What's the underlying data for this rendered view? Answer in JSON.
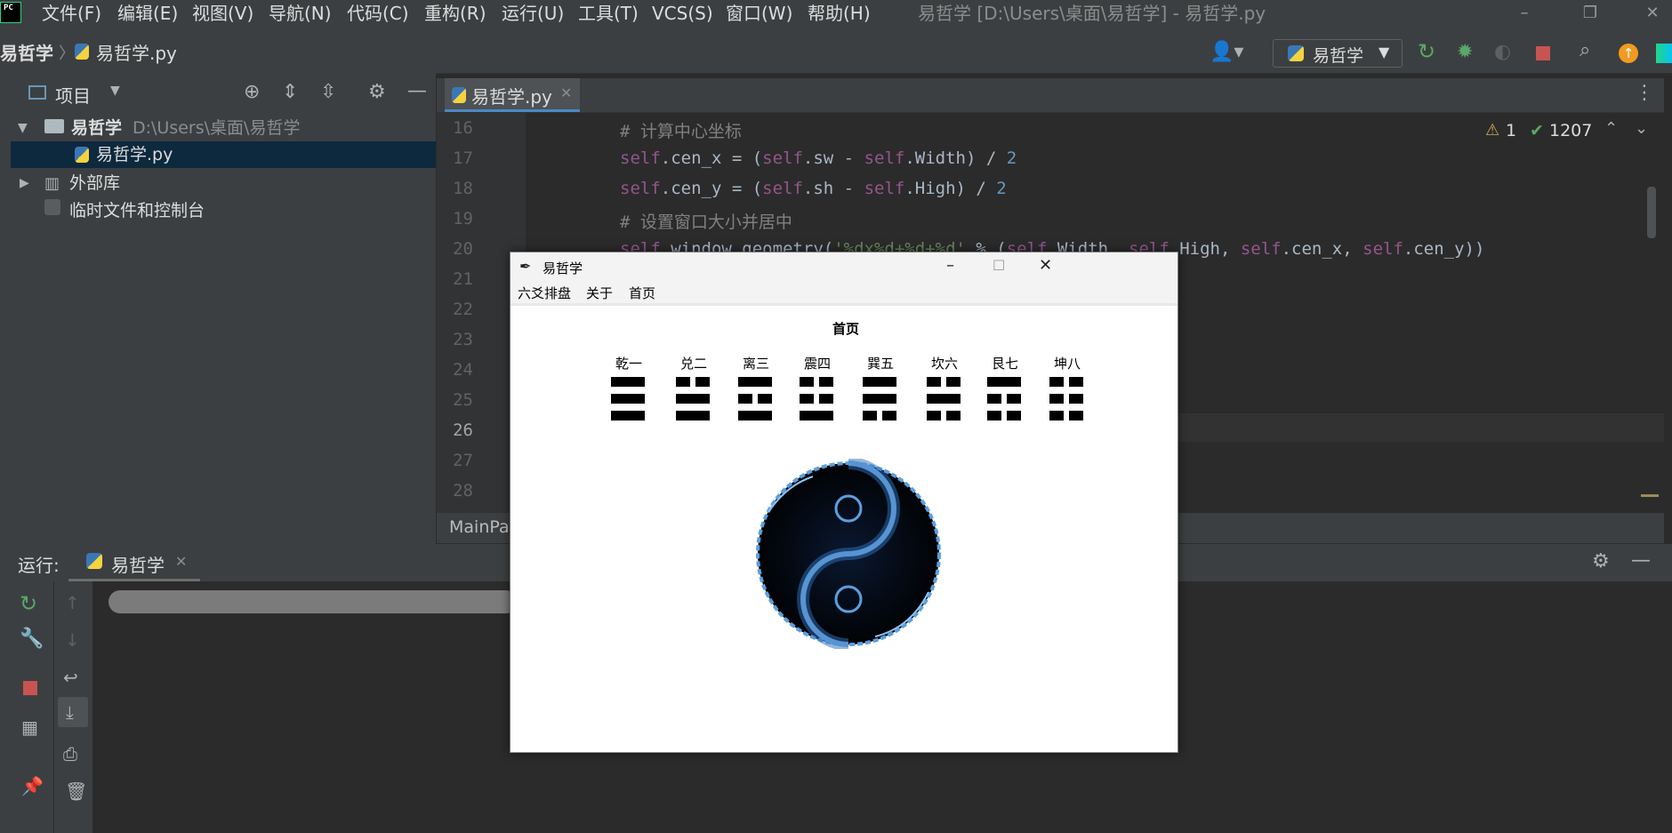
{
  "menubar": {
    "logo_text": "PC",
    "items": [
      "文件(F)",
      "编辑(E)",
      "视图(V)",
      "导航(N)",
      "代码(C)",
      "重构(R)",
      "运行(U)",
      "工具(T)",
      "VCS(S)",
      "窗口(W)",
      "帮助(H)"
    ],
    "window_title": "易哲学 [D:\\Users\\桌面\\易哲学] - 易哲学.py"
  },
  "navbar": {
    "crumb_project": "易哲学",
    "crumb_file": "易哲学.py",
    "run_config": "易哲学"
  },
  "project_panel": {
    "title": "项目",
    "root_name": "易哲学",
    "root_path": "D:\\Users\\桌面\\易哲学",
    "file": "易哲学.py",
    "external_libs": "外部库",
    "scratches": "临时文件和控制台"
  },
  "editor": {
    "tab_label": "易哲学.py",
    "warnings": "1",
    "checks": "1207",
    "line_numbers": [
      "16",
      "17",
      "18",
      "19",
      "20",
      "21",
      "22",
      "23",
      "24",
      "25",
      "26",
      "27",
      "28"
    ],
    "code": {
      "l16": "# 计算中心坐标",
      "l17_a": "self",
      "l17_b": ".cen_x = (",
      "l17_c": "self",
      "l17_d": ".sw - ",
      "l17_e": "self",
      "l17_f": ".Width) / ",
      "l17_g": "2",
      "l18_a": "self",
      "l18_b": ".cen_y = (",
      "l18_c": "self",
      "l18_d": ".sh - ",
      "l18_e": "self",
      "l18_f": ".High) / ",
      "l18_g": "2",
      "l19": "# 设置窗口大小并居中",
      "l20_a": "self",
      "l20_b": ".window.geometry(",
      "l20_c": "'%dx%d+%d+%d'",
      "l20_d": " % (",
      "l20_e": "self",
      "l20_f": ".Width, ",
      "l20_g": "self",
      "l20_h": ".High, ",
      "l20_i": "self",
      "l20_j": ".cen_x, ",
      "l20_k": "self",
      "l20_l": ".cen_y))"
    },
    "breadcrumb": "MainPa"
  },
  "run_panel": {
    "label": "运行:",
    "tab": "易哲学"
  },
  "tk_window": {
    "title": "易哲学",
    "menu": [
      "六爻排盘",
      "关于",
      "首页"
    ],
    "page_title": "首页",
    "trigrams": [
      {
        "name": "乾一",
        "lines": [
          1,
          1,
          1
        ]
      },
      {
        "name": "兑二",
        "lines": [
          0,
          1,
          1
        ]
      },
      {
        "name": "离三",
        "lines": [
          1,
          0,
          1
        ]
      },
      {
        "name": "震四",
        "lines": [
          0,
          0,
          1
        ]
      },
      {
        "name": "巽五",
        "lines": [
          1,
          1,
          0
        ]
      },
      {
        "name": "坎六",
        "lines": [
          0,
          1,
          0
        ]
      },
      {
        "name": "艮七",
        "lines": [
          1,
          0,
          0
        ]
      },
      {
        "name": "坤八",
        "lines": [
          0,
          0,
          0
        ]
      }
    ],
    "image": "yin-yang-water-image"
  },
  "colors": {
    "ide_bg": "#2b2b2b",
    "panel_bg": "#3c3f41",
    "selection": "#0d293e",
    "self_kw": "#94558d",
    "number": "#6897bb",
    "string": "#6a8759",
    "comment": "#808080",
    "accent_blue": "#4a88c7"
  }
}
